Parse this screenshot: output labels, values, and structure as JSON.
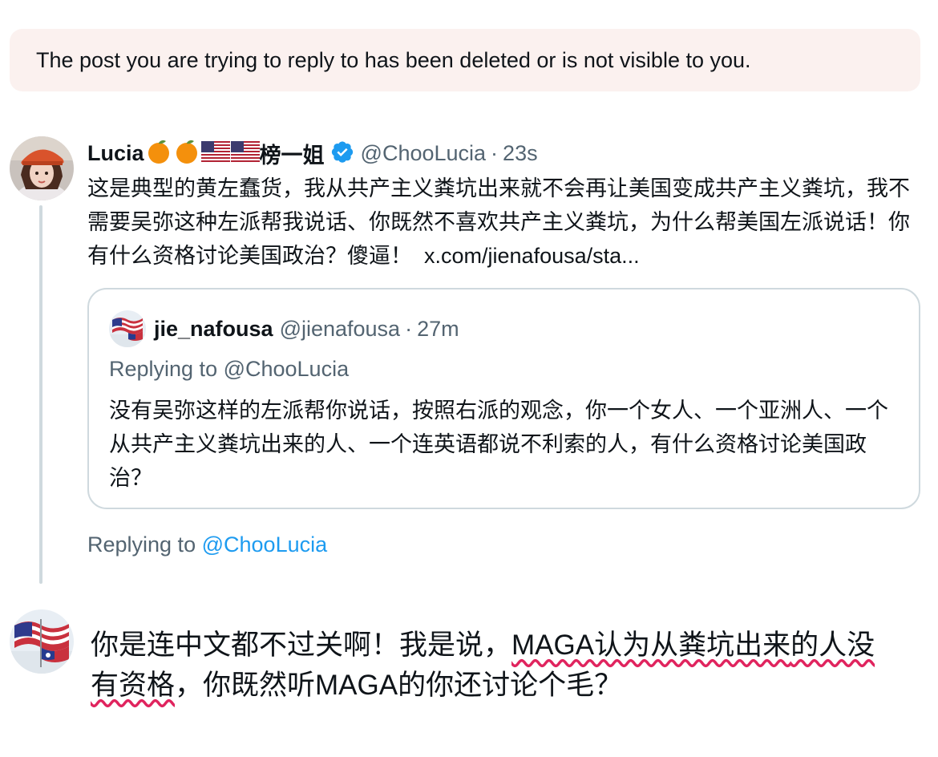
{
  "notice": {
    "text": "The post you are trying to reply to has been deleted or is not visible to you."
  },
  "tweet": {
    "display_name": "Lucia",
    "name_suffix": "榜一姐",
    "name_emojis": [
      "orange",
      "orange",
      "us-flag",
      "us-flag"
    ],
    "verified": true,
    "handle": "@ChooLucia",
    "separator": "·",
    "time": "23s",
    "text": "这是典型的黄左蠢货，我从共产主义粪坑出来就不会再让美国变成共产主义粪坑，我不需要吴弥这种左派帮我说话、你既然不喜欢共产主义粪坑，为什么帮美国左派说话！你有什么资格讨论美国政治？傻逼！",
    "link": "x.com/jienafousa/sta..."
  },
  "quote": {
    "display_name": "jie_nafousa",
    "handle": "@jienafousa",
    "separator": "·",
    "time": "27m",
    "replying_to": "Replying to @ChooLucia",
    "text": "没有吴弥这样的左派帮你说话，按照右派的观念，你一个女人、一个亚洲人、一个从共产主义粪坑出来的人、一个连英语都说不利索的人，有什么资格讨论美国政治？"
  },
  "replying": {
    "prefix": "Replying to",
    "mention": "@ChooLucia"
  },
  "reply": {
    "text_part1": "你是连中文都不过关啊！我是说，",
    "text_part2": "MAGA认为从粪坑出来",
    "text_part3": "的人没有资格",
    "text_part4": "，你既然听MAGA的你还讨论个毛？"
  },
  "colors": {
    "accent": "#1d9bf0",
    "secondary_text": "#536471",
    "notice_bg": "#fbf1ef",
    "spellcheck": "#e0245e"
  }
}
